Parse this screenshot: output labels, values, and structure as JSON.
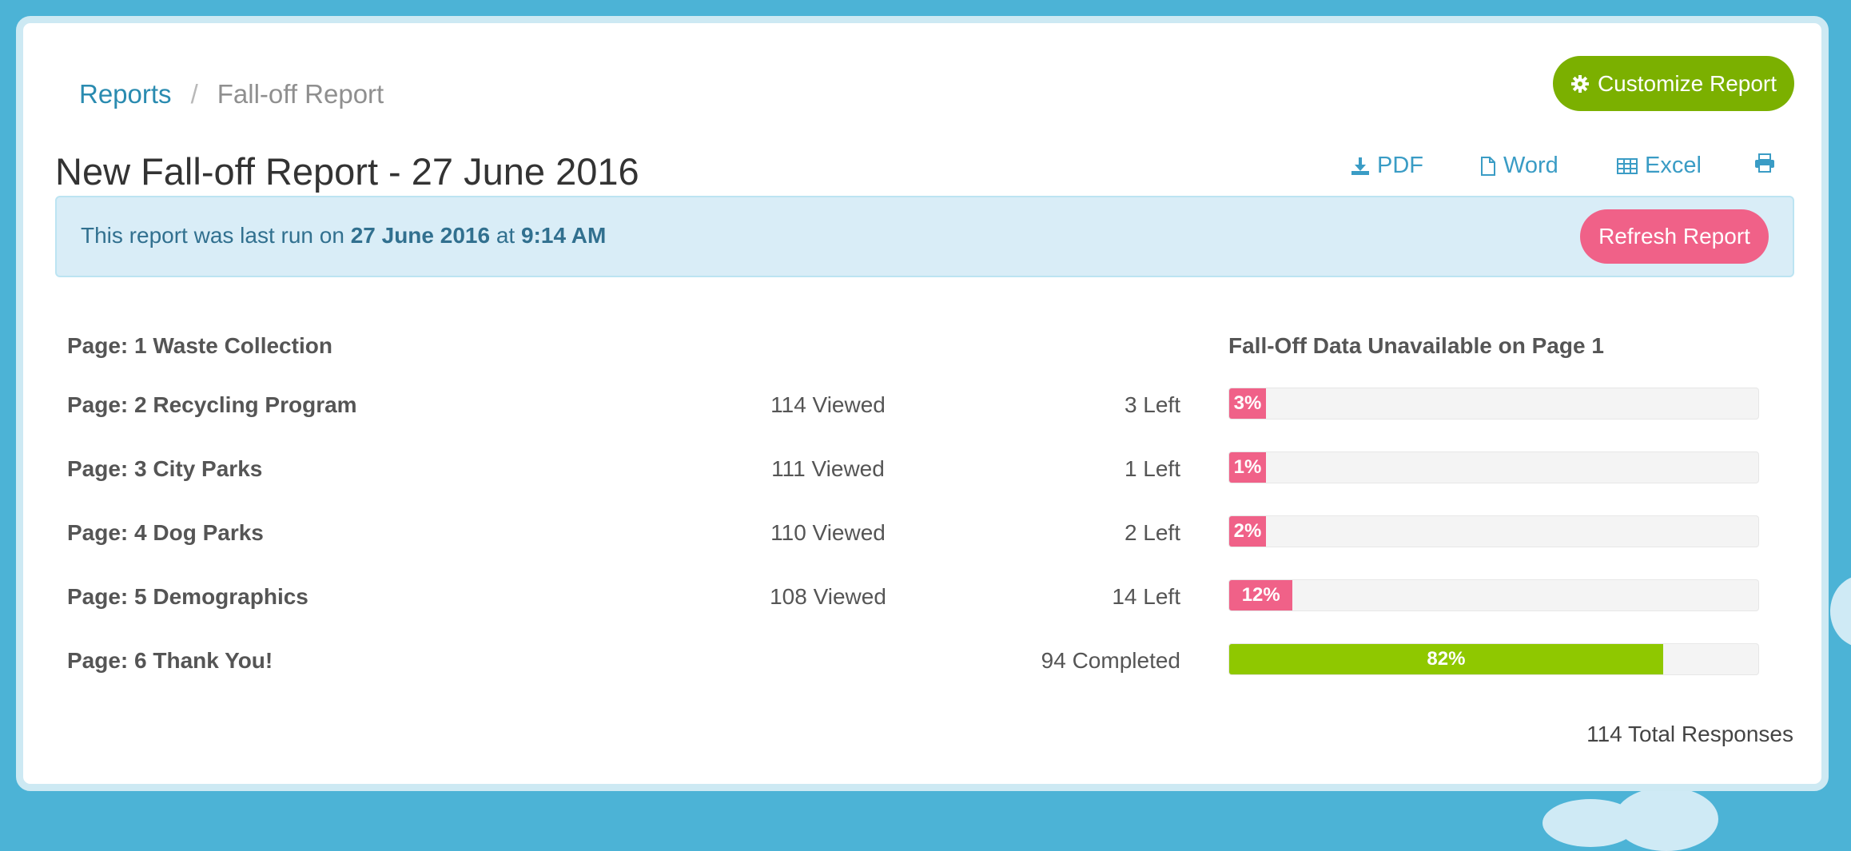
{
  "colors": {
    "accent": "#2a8bb0",
    "customize": "#7bb000",
    "refresh": "#f06188",
    "drop_bar": "#f06188",
    "complete_bar": "#8fc800",
    "alert_bg": "#d9edf7"
  },
  "breadcrumb": {
    "root": "Reports",
    "separator": "/",
    "current": "Fall-off Report"
  },
  "toolbar": {
    "customize_label": "Customize Report",
    "customize_icon": "gear-icon"
  },
  "title": "New Fall-off Report - 27 June 2016",
  "exports": [
    {
      "label": "PDF",
      "icon": "download-icon"
    },
    {
      "label": "Word",
      "icon": "document-icon"
    },
    {
      "label": "Excel",
      "icon": "table-icon"
    },
    {
      "label": "",
      "icon": "print-icon"
    }
  ],
  "alert": {
    "prefix": "This report was last run on",
    "date": "27 June 2016",
    "middle": "at",
    "time": "9:14 AM",
    "refresh_label": "Refresh Report"
  },
  "rows": [
    {
      "label": "Page: 1 Waste Collection",
      "viewed": "",
      "left": "",
      "note": "Fall-Off Data Unavailable on Page 1",
      "percent": null,
      "percent_label": ""
    },
    {
      "label": "Page: 2 Recycling Program",
      "viewed": "114 Viewed",
      "left": "3 Left",
      "note": "",
      "percent": 3,
      "percent_label": "3%"
    },
    {
      "label": "Page: 3 City Parks",
      "viewed": "111 Viewed",
      "left": "1 Left",
      "note": "",
      "percent": 1,
      "percent_label": "1%"
    },
    {
      "label": "Page: 4 Dog Parks",
      "viewed": "110 Viewed",
      "left": "2 Left",
      "note": "",
      "percent": 2,
      "percent_label": "2%"
    },
    {
      "label": "Page: 5 Demographics",
      "viewed": "108 Viewed",
      "left": "14 Left",
      "note": "",
      "percent": 12,
      "percent_label": "12%"
    },
    {
      "label": "Page: 6 Thank You!",
      "viewed": "",
      "left": "94 Completed",
      "note": "",
      "percent": 82,
      "percent_label": "82%",
      "complete": true
    }
  ],
  "total": "114 Total Responses"
}
